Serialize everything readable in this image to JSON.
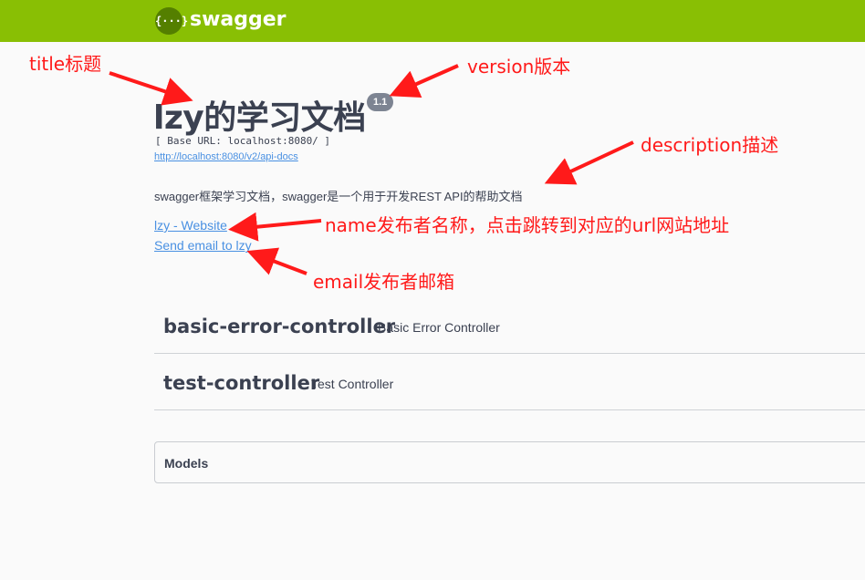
{
  "header": {
    "logo_glyph": "{···}",
    "brand": "swagger",
    "bar_color": "#89bf04"
  },
  "info": {
    "title": "lzy的学习文档",
    "version": "1.1",
    "base_url": "[ Base URL: localhost:8080/ ]",
    "api_docs_link": "http://localhost:8080/v2/api-docs",
    "description": "swagger框架学习文档，swagger是一个用于开发REST API的帮助文档",
    "website_link": "lzy - Website",
    "email_link": "Send email to lzy"
  },
  "tags": [
    {
      "name": "basic-error-controller",
      "description": "Basic Error Controller"
    },
    {
      "name": "test-controller",
      "description": "Test Controller"
    }
  ],
  "models": {
    "label": "Models"
  },
  "annotations": {
    "title": "title标题",
    "version": "version版本",
    "description": "description描述",
    "name": "name发布者名称，点击跳转到对应的url网站地址",
    "email": "email发布者邮箱",
    "color": "#ff1a1a"
  }
}
